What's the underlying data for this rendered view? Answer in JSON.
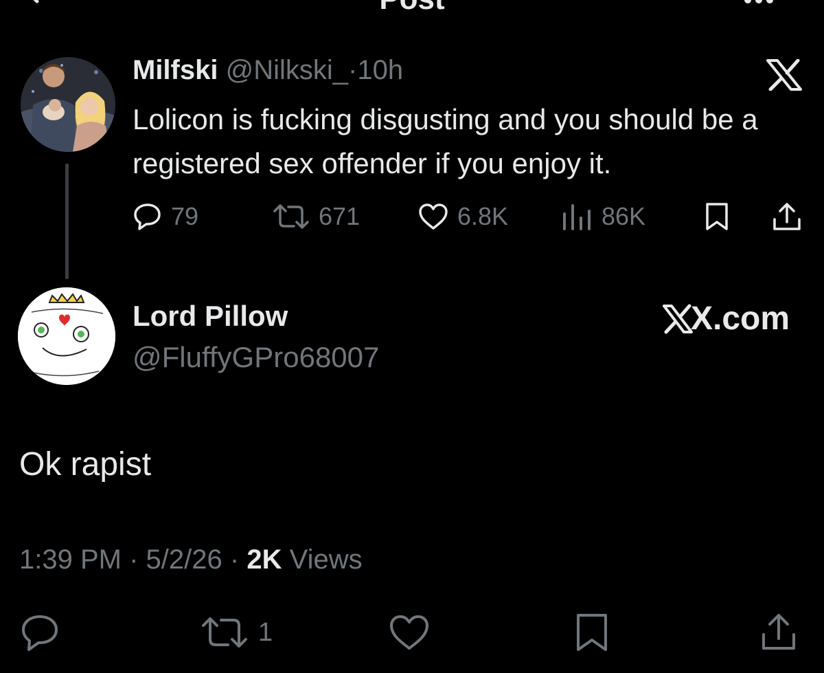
{
  "header": {
    "title": "Post"
  },
  "parent_post": {
    "display_name": "Milfski",
    "handle": "@Nilkski_",
    "separator": "·",
    "time": "10h",
    "text": "Lolicon is fucking disgusting and you should be a registered sex offender if you enjoy it.",
    "actions": {
      "replies": "79",
      "reposts": "671",
      "likes": "6.8K",
      "views": "86K"
    }
  },
  "reply_post": {
    "display_name": "Lord Pillow",
    "handle": "@FluffyGPro68007",
    "brand": "X.com",
    "text": "Ok rapist",
    "meta": {
      "time": "1:39 PM",
      "sep1": "·",
      "date": "5/2/26",
      "sep2": "·",
      "views_count": "2K",
      "views_label": "Views"
    },
    "actions": {
      "reposts": "1"
    }
  },
  "colors": {
    "background": "#000000",
    "text": "#e7e9ea",
    "muted": "#71767b",
    "thread_line": "#3a3d42"
  },
  "icons": [
    "back-arrow-icon",
    "more-icon",
    "x-logo-icon",
    "reply-icon",
    "repost-icon",
    "like-icon",
    "views-icon",
    "bookmark-icon",
    "share-icon"
  ]
}
